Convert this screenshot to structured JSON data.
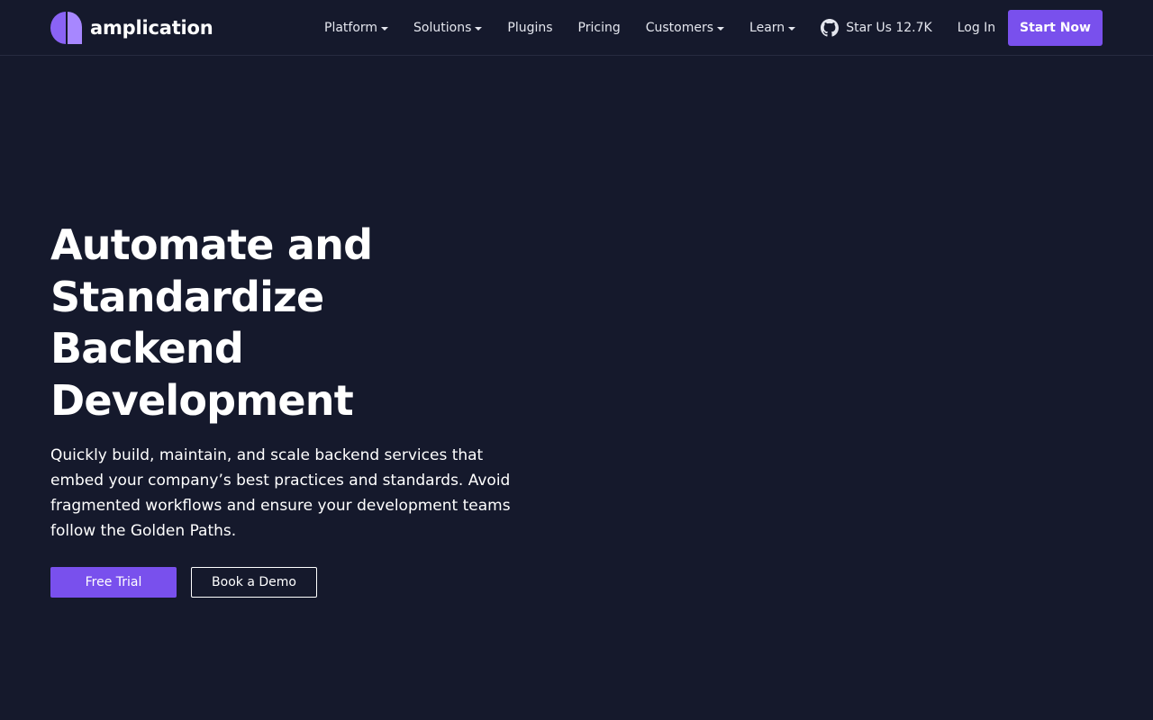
{
  "brand": {
    "name": "amplication",
    "logo_icon": "amplication-logo-icon"
  },
  "nav": {
    "platform": "Platform",
    "solutions": "Solutions",
    "plugins": "Plugins",
    "pricing": "Pricing",
    "customers": "Customers",
    "learn": "Learn",
    "github_label": "Star Us 12.7K",
    "github_icon": "github-icon",
    "login": "Log In",
    "start_now": "Start Now"
  },
  "hero": {
    "title_line1": "Automate and",
    "title_line2": "Standardize",
    "title_line3": "Backend",
    "title_line4": "Development",
    "subtitle": "Quickly build, maintain, and scale backend services that embed your company’s best practices and standards. Avoid fragmented workflows and ensure your development teams follow the Golden Paths.",
    "free_trial": "Free Trial",
    "book_demo": "Book a Demo"
  },
  "colors": {
    "background": "#15192c",
    "accent": "#7950ed",
    "text": "#ffffff"
  }
}
